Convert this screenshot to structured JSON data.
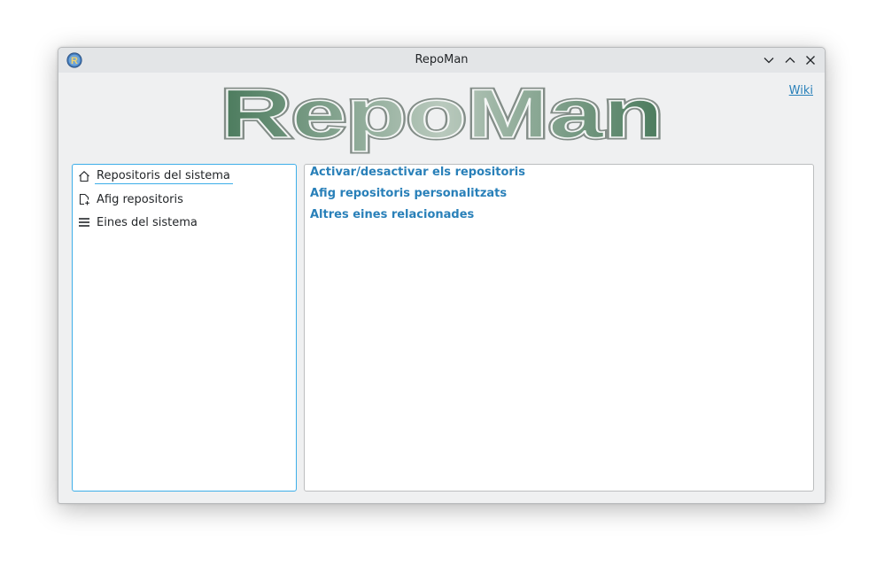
{
  "window": {
    "title": "RepoMan",
    "app_icon": "repoman-app-icon",
    "controls": [
      "minimize-icon",
      "maximize-icon",
      "close-icon"
    ]
  },
  "header": {
    "logo_text": "RepoMan",
    "wiki_link": "Wiki"
  },
  "sidebar": {
    "items": [
      {
        "label": "Repositoris del sistema",
        "icon": "home-icon",
        "selected": true
      },
      {
        "label": "Afig repositoris",
        "icon": "add-document-icon",
        "selected": false
      },
      {
        "label": "Eines del sistema",
        "icon": "menu-lines-icon",
        "selected": false
      }
    ]
  },
  "main": {
    "links": [
      {
        "label": "Activar/desactivar els repositoris"
      },
      {
        "label": "Afig repositoris personalitzats"
      },
      {
        "label": "Altres eines relacionades"
      }
    ]
  },
  "colors": {
    "accent": "#3daee9",
    "link": "#2980b9",
    "logo_fill_dark": "#4a7a5c",
    "logo_fill_light": "#b9c9bd"
  }
}
